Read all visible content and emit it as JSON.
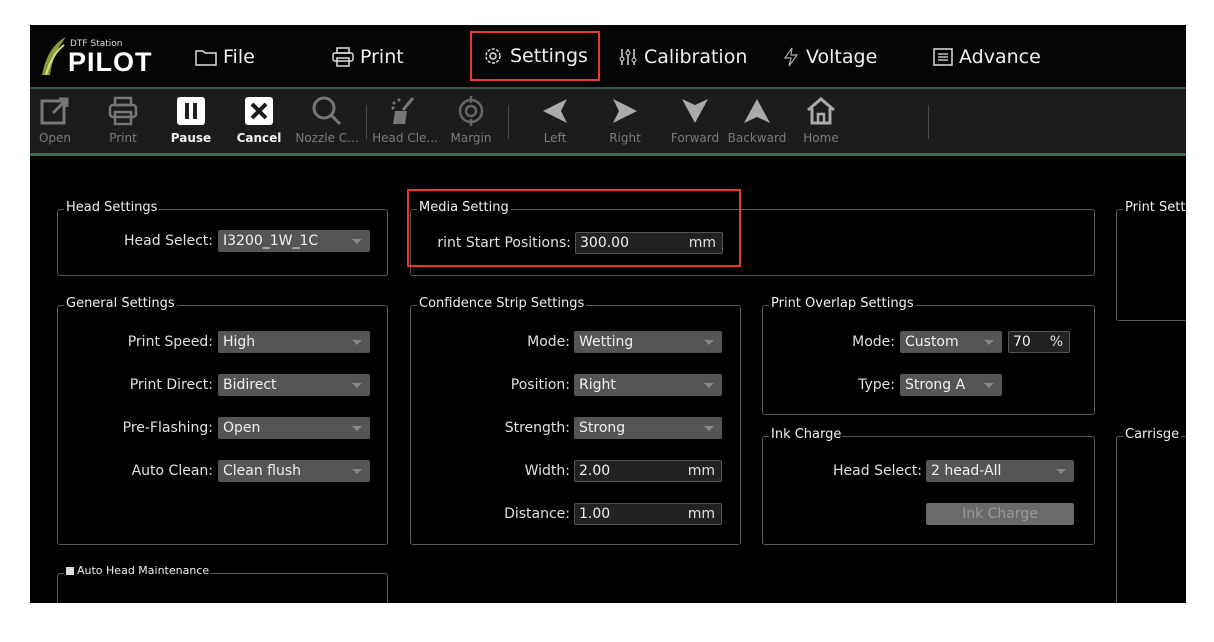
{
  "logo": {
    "small": "DTF Station",
    "big": "PILOT"
  },
  "menu": [
    {
      "label": "File",
      "icon": "folder-icon"
    },
    {
      "label": "Print",
      "icon": "printer-icon"
    },
    {
      "label": "Settings",
      "icon": "gear-icon"
    },
    {
      "label": "Calibration",
      "icon": "sliders-icon"
    },
    {
      "label": "Voltage",
      "icon": "bolt-icon"
    },
    {
      "label": "Advance",
      "icon": "list-icon"
    }
  ],
  "toolbar": {
    "open": "Open",
    "print": "Print",
    "pause": "Pause",
    "cancel": "Cancel",
    "nozzle": "Nozzle C...",
    "headclean": "Head Cle...",
    "margin": "Margin",
    "left": "Left",
    "right": "Right",
    "forward": "Forward",
    "backward": "Backward",
    "home": "Home"
  },
  "head": {
    "title": "Head Settings",
    "label": "Head Select:",
    "value": "I3200_1W_1C"
  },
  "media": {
    "title": "Media Setting",
    "label": "rint Start Positions:",
    "value": "300.00",
    "unit": "mm"
  },
  "printset": {
    "title": "Print Sett"
  },
  "general": {
    "title": "General Settings",
    "speed_label": "Print Speed:",
    "speed": "High",
    "direct_label": "Print Direct:",
    "direct": "Bidirect",
    "flash_label": "Pre-Flashing:",
    "flash": "Open",
    "clean_label": "Auto Clean:",
    "clean": "Clean flush"
  },
  "confidence": {
    "title": "Confidence Strip Settings",
    "mode_label": "Mode:",
    "mode": "Wetting",
    "pos_label": "Position:",
    "pos": "Right",
    "str_label": "Strength:",
    "str": "Strong",
    "width_label": "Width:",
    "width": "2.00",
    "width_unit": "mm",
    "dist_label": "Distance:",
    "dist": "1.00",
    "dist_unit": "mm"
  },
  "overlap": {
    "title": "Print Overlap  Settings",
    "mode_label": "Mode:",
    "mode": "Custom",
    "pct": "70",
    "pct_unit": "%",
    "type_label": "Type:",
    "type": "Strong A"
  },
  "ink": {
    "title": "Ink Charge",
    "head_label": "Head Select:",
    "head": "2 head-All",
    "button": "Ink Charge"
  },
  "carriage": {
    "title": "Carrisge"
  },
  "autohead": {
    "title": "Auto Head Maintenance"
  },
  "colors": {
    "accent": "#e53b27",
    "bg": "#000000",
    "select": "#555555",
    "divider": "#3b6a52"
  }
}
